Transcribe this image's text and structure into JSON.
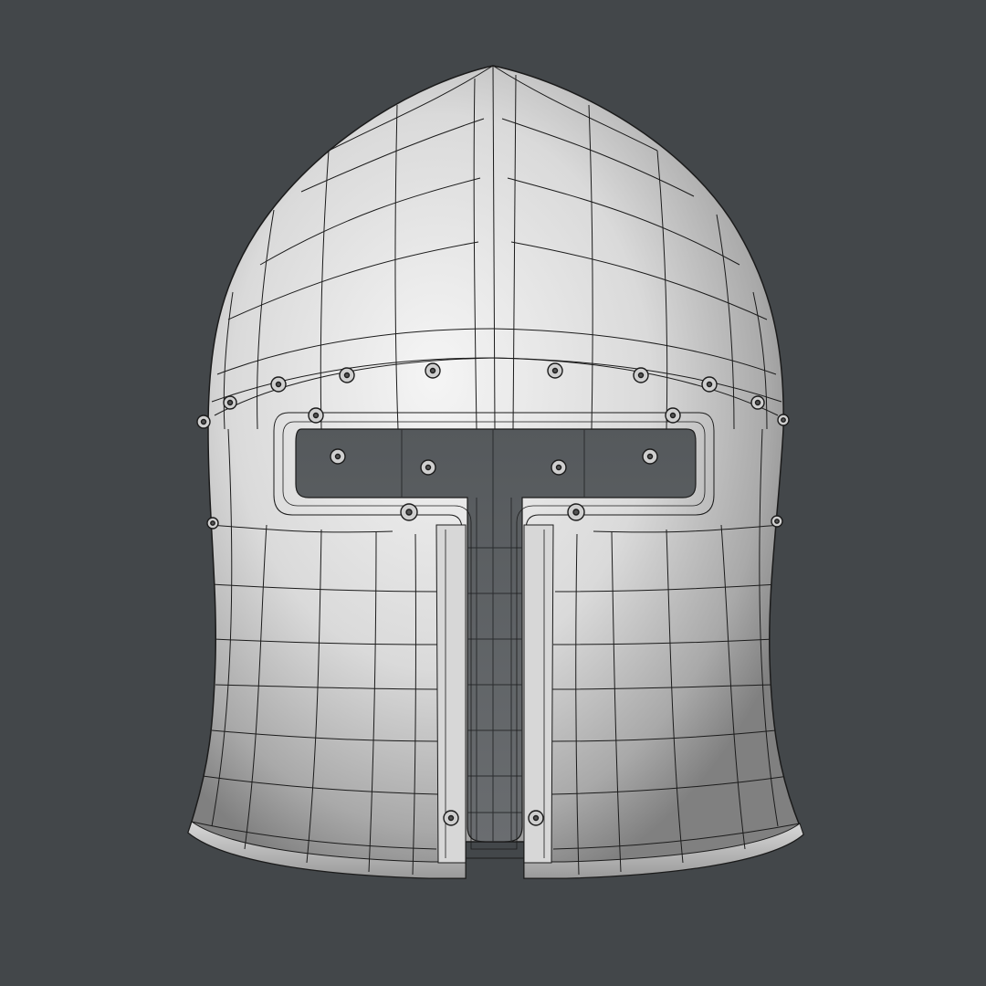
{
  "viewport": {
    "background": "#43474a",
    "model": "barbute-helmet",
    "shading": "smooth-with-wireframe",
    "colors": {
      "surface_light": "#f4f4f4",
      "surface_mid": "#c2c2c2",
      "surface_dark": "#858585",
      "wire": "#1b1b1b",
      "opening": "#4a4e51",
      "rivet": "#6a6a6a"
    }
  }
}
